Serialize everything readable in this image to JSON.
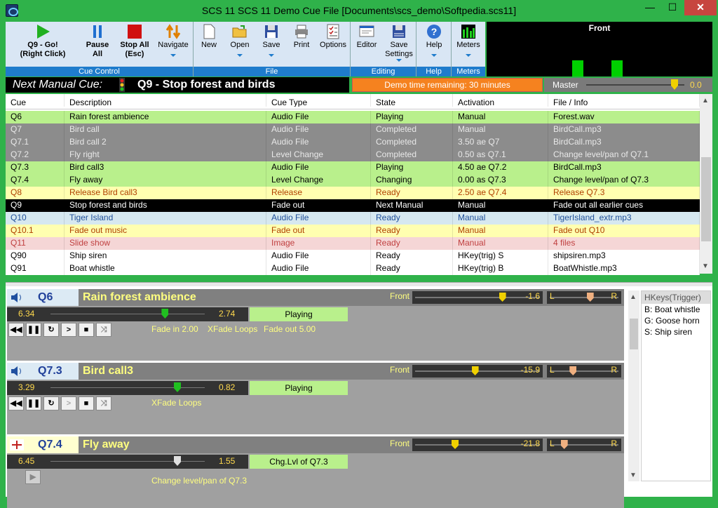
{
  "window": {
    "title": "SCS 11  SCS 11 Demo Cue File [Documents\\scs_demo\\Softpedia.scs11]",
    "min": "—",
    "max": "☐",
    "close": "✕"
  },
  "toolbar": {
    "groups": [
      {
        "label": "Cue Control"
      },
      {
        "label": "File"
      },
      {
        "label": "Editing"
      },
      {
        "label": "Help"
      },
      {
        "label": "Meters"
      }
    ],
    "go": "Q9 - Go!\n(Right Click)",
    "pause": "Pause\nAll",
    "stop": "Stop All\n(Esc)",
    "navigate": "Navigate",
    "new": "New",
    "open": "Open",
    "save": "Save",
    "print": "Print",
    "options": "Options",
    "editor": "Editor",
    "save_settings": "Save\nSettings",
    "help": "Help",
    "meters": "Meters"
  },
  "meter_panel": {
    "title": "Front",
    "levels": [
      0.3,
      0.3
    ]
  },
  "next_manual": {
    "label": "Next Manual Cue:",
    "cue": "Q9 - Stop forest and birds"
  },
  "demo_time": "Demo time remaining: 30 minutes",
  "master": {
    "label": "Master",
    "value": "0.0",
    "level": 0.9
  },
  "cuelist": {
    "headers": [
      "Cue",
      "Description",
      "Cue Type",
      "State",
      "Activation",
      "File / Info"
    ],
    "rows": [
      {
        "cells": [
          "Q6",
          "Rain forest ambience",
          "Audio File",
          "Playing",
          "Manual",
          "Forest.wav"
        ],
        "bg": "#b9f08c",
        "fg": "#000000"
      },
      {
        "cells": [
          "Q7",
          "Bird call",
          "Audio File",
          "Completed",
          "Manual",
          "BirdCall.mp3"
        ],
        "bg": "#8c8c8c",
        "fg": "#e8e8e8"
      },
      {
        "cells": [
          "Q7.1",
          "Bird call 2",
          "Audio File",
          "Completed",
          "3.50 ae Q7",
          "BirdCall.mp3"
        ],
        "bg": "#8c8c8c",
        "fg": "#e8e8e8"
      },
      {
        "cells": [
          "Q7.2",
          "Fly right",
          "Level Change",
          "Completed",
          "0.50 as Q7.1",
          "Change level/pan of Q7.1"
        ],
        "bg": "#8c8c8c",
        "fg": "#e8e8e8"
      },
      {
        "cells": [
          "Q7.3",
          "Bird call3",
          "Audio File",
          "Playing",
          "4.50 ae Q7.2",
          "BirdCall.mp3"
        ],
        "bg": "#b9f08c",
        "fg": "#000000"
      },
      {
        "cells": [
          "Q7.4",
          "Fly away",
          "Level Change",
          "Changing",
          "0.00 as Q7.3",
          "Change level/pan of Q7.3"
        ],
        "bg": "#b9f08c",
        "fg": "#000000"
      },
      {
        "cells": [
          "Q8",
          "Release Bird call3",
          "Release",
          "Ready",
          "2.50 ae Q7.4",
          "Release Q7.3"
        ],
        "bg": "#ffffb0",
        "fg": "#b04000"
      },
      {
        "cells": [
          "Q9",
          "Stop forest and birds",
          "Fade out",
          "Next Manual",
          "Manual",
          "Fade out all earlier cues"
        ],
        "bg": "#000000",
        "fg": "#ffffff"
      },
      {
        "cells": [
          "Q10",
          "Tiger Island",
          "Audio File",
          "Ready",
          "Manual",
          "TigerIsland_extr.mp3"
        ],
        "bg": "#d6e8f0",
        "fg": "#20509a"
      },
      {
        "cells": [
          "Q10.1",
          "Fade out music",
          "Fade out",
          "Ready",
          "Manual",
          "Fade out Q10"
        ],
        "bg": "#ffffb0",
        "fg": "#b04000"
      },
      {
        "cells": [
          "Q11",
          "Slide show",
          "Image",
          "Ready",
          "Manual",
          "4 files"
        ],
        "bg": "#f5d6d6",
        "fg": "#c04040"
      },
      {
        "cells": [
          "Q90",
          "Ship siren",
          "Audio File",
          "Ready",
          "HKey(trig) S",
          "shipsiren.mp3"
        ],
        "bg": "#ffffff",
        "fg": "#000000"
      },
      {
        "cells": [
          "Q91",
          "Boat whistle",
          "Audio File",
          "Ready",
          "HKey(trig) B",
          "BoatWhistle.mp3"
        ],
        "bg": "#ffffff",
        "fg": "#000000"
      }
    ]
  },
  "panels": [
    {
      "id": "Q6",
      "desc": "Rain forest ambience",
      "front": "Front",
      "level": "-1.6",
      "L": "L",
      "R": "R",
      "pos_start": "6.34",
      "pos_end": "2.74",
      "state": "Playing",
      "info": [
        "Fade in 2.00",
        "XFade Loops",
        "Fade out 5.00"
      ],
      "level_frac": 0.92,
      "pan_frac": 0.55,
      "pos_frac": 0.72
    },
    {
      "id": "Q7.3",
      "desc": "Bird call3",
      "front": "Front",
      "level": "-15.9",
      "L": "L",
      "R": "R",
      "pos_start": "3.29",
      "pos_end": "0.82",
      "state": "Playing",
      "info": [
        "XFade Loops"
      ],
      "level_frac": 0.62,
      "pan_frac": 0.22,
      "pos_frac": 0.8
    },
    {
      "id": "Q7.4",
      "desc": "Fly away",
      "front": "Front",
      "level": "-21.8",
      "L": "L",
      "R": "R",
      "pos_start": "6.45",
      "pos_end": "1.55",
      "state": "Chg.Lvl of Q7.3",
      "info": [
        "Change level/pan of Q7.3"
      ],
      "level_frac": 0.4,
      "pan_frac": 0.05,
      "pos_frac": 0.8
    }
  ],
  "hkeys": {
    "title": "HKeys(Trigger)",
    "items": [
      "B: Boat whistle",
      "G: Goose horn",
      "S: Ship siren"
    ]
  }
}
